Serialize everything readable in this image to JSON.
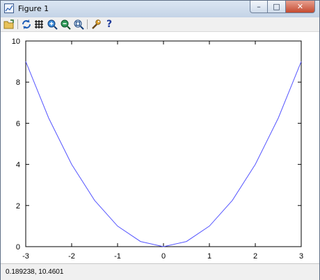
{
  "window": {
    "title": "Figure 1",
    "caption_buttons": {
      "minimize": "–",
      "maximize": "□",
      "close": "✕"
    }
  },
  "toolbar": {
    "items": [
      {
        "icon": "open-folder-icon"
      },
      {
        "icon": "refresh-icon"
      },
      {
        "icon": "grid-icon"
      },
      {
        "icon": "zoom-in-icon"
      },
      {
        "icon": "zoom-out-icon"
      },
      {
        "icon": "zoom-fit-icon"
      },
      {
        "icon": "wrench-icon"
      },
      {
        "icon": "help-icon",
        "text": "?"
      }
    ]
  },
  "chart_data": {
    "type": "line",
    "title": "",
    "xlabel": "",
    "ylabel": "",
    "xlim": [
      -3,
      3
    ],
    "ylim": [
      0,
      10
    ],
    "xticks": [
      "-3",
      "-2",
      "-1",
      "0",
      "1",
      "2",
      "3"
    ],
    "yticks": [
      "0",
      "2",
      "4",
      "6",
      "8",
      "10"
    ],
    "grid": false,
    "series": [
      {
        "color": "#5555ff",
        "x": [
          -3,
          -2.5,
          -2,
          -1.5,
          -1,
          -0.5,
          0,
          0.5,
          1,
          1.5,
          2,
          2.5,
          3
        ],
        "y": [
          9,
          6.25,
          4,
          2.25,
          1,
          0.25,
          0,
          0.25,
          1,
          2.25,
          4,
          6.25,
          9
        ]
      }
    ]
  },
  "status": {
    "coordinates": "0.189238,  10.4601"
  }
}
